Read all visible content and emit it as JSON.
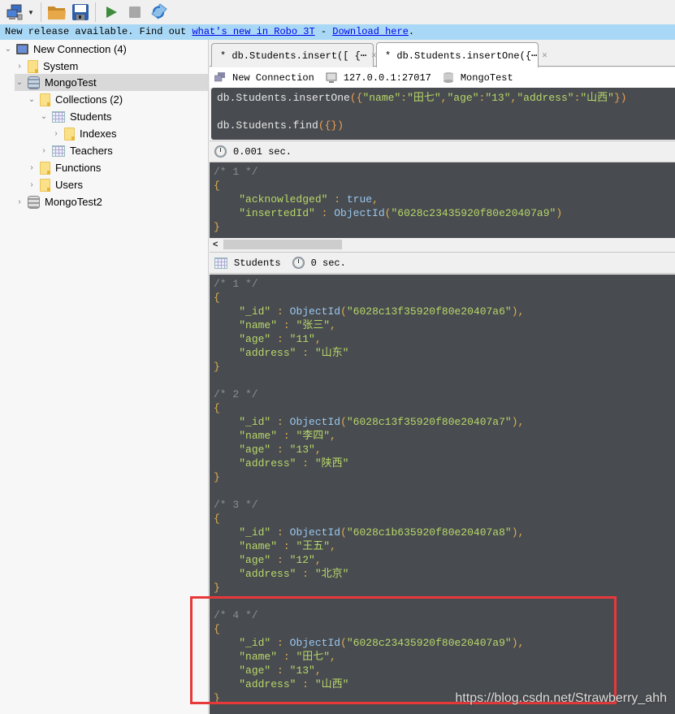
{
  "toolbar": {
    "buttons": [
      {
        "name": "connect",
        "icon": "computer-network-icon"
      },
      {
        "name": "open",
        "icon": "folder-open-icon"
      },
      {
        "name": "save",
        "icon": "floppy-disk-icon"
      },
      {
        "name": "execute",
        "icon": "play-icon"
      },
      {
        "name": "stop",
        "icon": "stop-icon"
      },
      {
        "name": "sync",
        "icon": "sync-icon"
      }
    ]
  },
  "banner": {
    "prefix": "New release available. Find out ",
    "link1": "what's new in Robo 3T",
    "middle": " - ",
    "link2": "Download here",
    "suffix": "."
  },
  "sidebar": {
    "items": [
      {
        "label": "New Connection (4)",
        "icon": "computer-icon",
        "expanded": true
      },
      {
        "label": "System",
        "icon": "folder-icon",
        "expanded": false
      },
      {
        "label": "MongoTest",
        "icon": "database-icon",
        "expanded": true,
        "selected": true
      },
      {
        "label": "Collections (2)",
        "icon": "folder-icon",
        "expanded": true
      },
      {
        "label": "Students",
        "icon": "collection-icon",
        "expanded": true
      },
      {
        "label": "Indexes",
        "icon": "folder-icon",
        "expanded": false
      },
      {
        "label": "Teachers",
        "icon": "collection-icon",
        "expanded": false
      },
      {
        "label": "Functions",
        "icon": "folder-icon",
        "expanded": false
      },
      {
        "label": "Users",
        "icon": "folder-icon",
        "expanded": false
      },
      {
        "label": "MongoTest2",
        "icon": "database-icon",
        "expanded": false
      }
    ]
  },
  "tabs": [
    {
      "label": "* db.Students.insert([  {⋯",
      "active": false
    },
    {
      "label": "* db.Students.insertOne({⋯",
      "active": true
    }
  ],
  "connection_bar": {
    "connection": "New Connection",
    "host": "127.0.0.1:27017",
    "database": "MongoTest"
  },
  "editor": {
    "line1": {
      "prefix": "db.Students.insertOne",
      "open": "({",
      "k1": "\"name\"",
      "v1": "\"田七\"",
      "k2": "\"age\"",
      "v2": "\"13\"",
      "k3": "\"address\"",
      "v3": "\"山西\"",
      "close": "})"
    },
    "line3": {
      "prefix": "db.Students.find",
      "args": "({})"
    }
  },
  "insert_result": {
    "time": "0.001 sec.",
    "comment": "/* 1 */",
    "acknowledged_key": "\"acknowledged\"",
    "acknowledged_val": "true",
    "insertedId_key": "\"insertedId\"",
    "insertedId_val": "\"6028c23435920f80e20407a9\""
  },
  "find_result": {
    "collection": "Students",
    "time": "0 sec.",
    "documents": [
      {
        "comment": "/* 1 */",
        "_id": "\"6028c13f35920f80e20407a6\"",
        "name": "\"张三\"",
        "age": "\"11\"",
        "address": "\"山东\""
      },
      {
        "comment": "/* 2 */",
        "_id": "\"6028c13f35920f80e20407a7\"",
        "name": "\"李四\"",
        "age": "\"13\"",
        "address": "\"陕西\""
      },
      {
        "comment": "/* 3 */",
        "_id": "\"6028c1b635920f80e20407a8\"",
        "name": "\"王五\"",
        "age": "\"12\"",
        "address": "\"北京\""
      },
      {
        "comment": "/* 4 */",
        "_id": "\"6028c23435920f80e20407a9\"",
        "name": "\"田七\"",
        "age": "\"13\"",
        "address": "\"山西\""
      }
    ]
  },
  "labels": {
    "object_id": "ObjectId",
    "id_key": "\"_id\"",
    "name_key": "\"name\"",
    "age_key": "\"age\"",
    "address_key": "\"address\""
  },
  "watermark": "https://blog.csdn.net/Strawberry_ahh",
  "colors": {
    "editor_bg": "#484b4f",
    "banner_bg": "#a8d8f5",
    "highlight": "#e8393a",
    "string": "#b8d86a",
    "keyword": "#9ac8f0"
  }
}
